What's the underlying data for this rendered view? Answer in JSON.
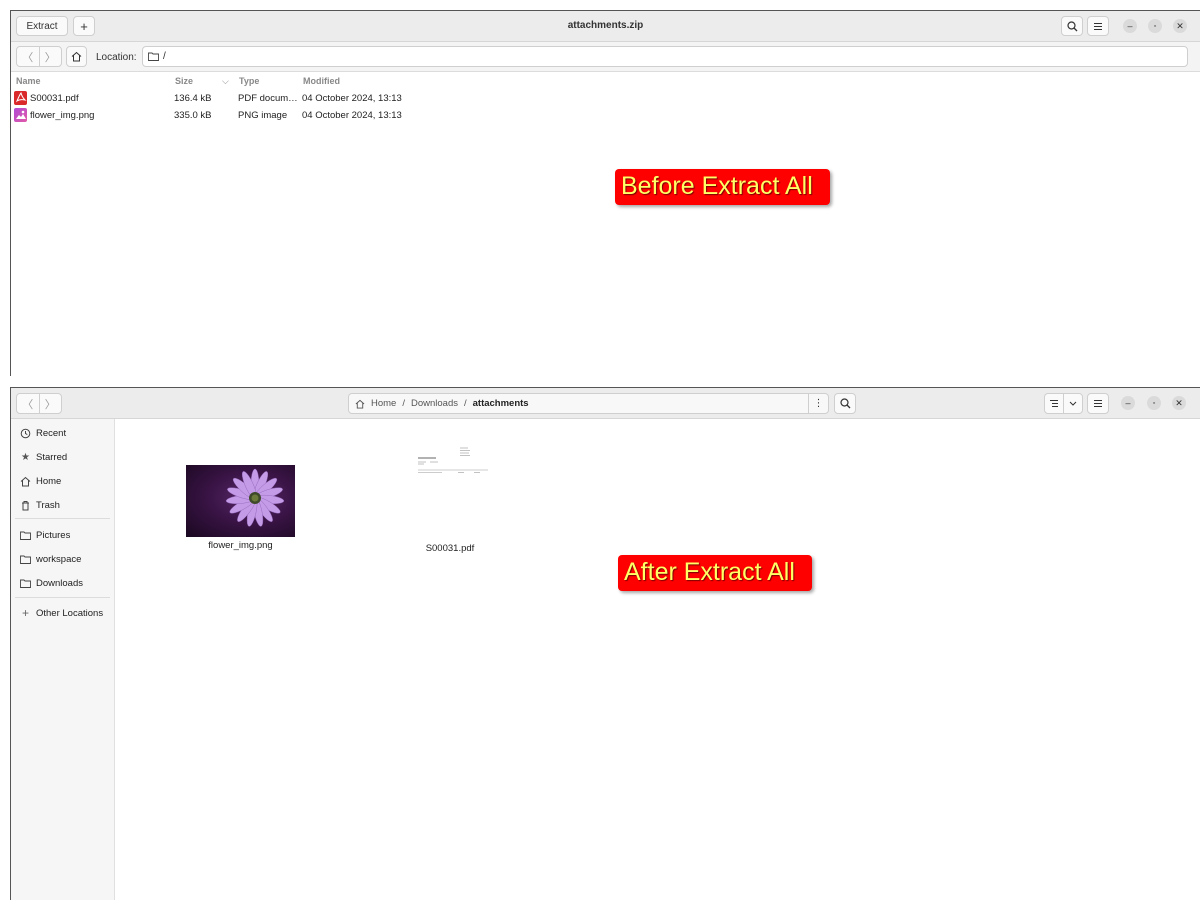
{
  "archive_window": {
    "title": "attachments.zip",
    "extract_label": "Extract",
    "add_label": "+",
    "location_label": "Location:",
    "location_value": "/",
    "columns": {
      "name": "Name",
      "size": "Size",
      "type": "Type",
      "modified": "Modified"
    },
    "files": [
      {
        "name": "S00031.pdf",
        "size": "136.4 kB",
        "type": "PDF docum…",
        "modified": "04 October 2024, 13:13",
        "icon": "pdf-file-icon"
      },
      {
        "name": "flower_img.png",
        "size": "335.0 kB",
        "type": "PNG image",
        "modified": "04 October 2024, 13:13",
        "icon": "image-file-icon"
      }
    ]
  },
  "annotations": {
    "before": "Before Extract All",
    "after": "After Extract All"
  },
  "files_window": {
    "breadcrumb": [
      "Home",
      "Downloads",
      "attachments"
    ],
    "sidebar": {
      "items": [
        {
          "label": "Recent",
          "icon": "clock-icon"
        },
        {
          "label": "Starred",
          "icon": "star-icon"
        },
        {
          "label": "Home",
          "icon": "home-icon"
        },
        {
          "label": "Trash",
          "icon": "trash-icon"
        },
        {
          "label": "Pictures",
          "icon": "folder-icon"
        },
        {
          "label": "workspace",
          "icon": "folder-icon"
        },
        {
          "label": "Downloads",
          "icon": "folder-icon"
        },
        {
          "label": "Other Locations",
          "icon": "plus-icon"
        }
      ]
    },
    "files": [
      {
        "name": "flower_img.png",
        "kind": "image-thumbnail"
      },
      {
        "name": "S00031.pdf",
        "kind": "pdf-thumbnail"
      }
    ]
  },
  "colors": {
    "badge_bg": "#ff0000",
    "badge_text": "#ffff66",
    "header_bg": "#ececec",
    "sidebar_bg": "#f6f6f6"
  }
}
